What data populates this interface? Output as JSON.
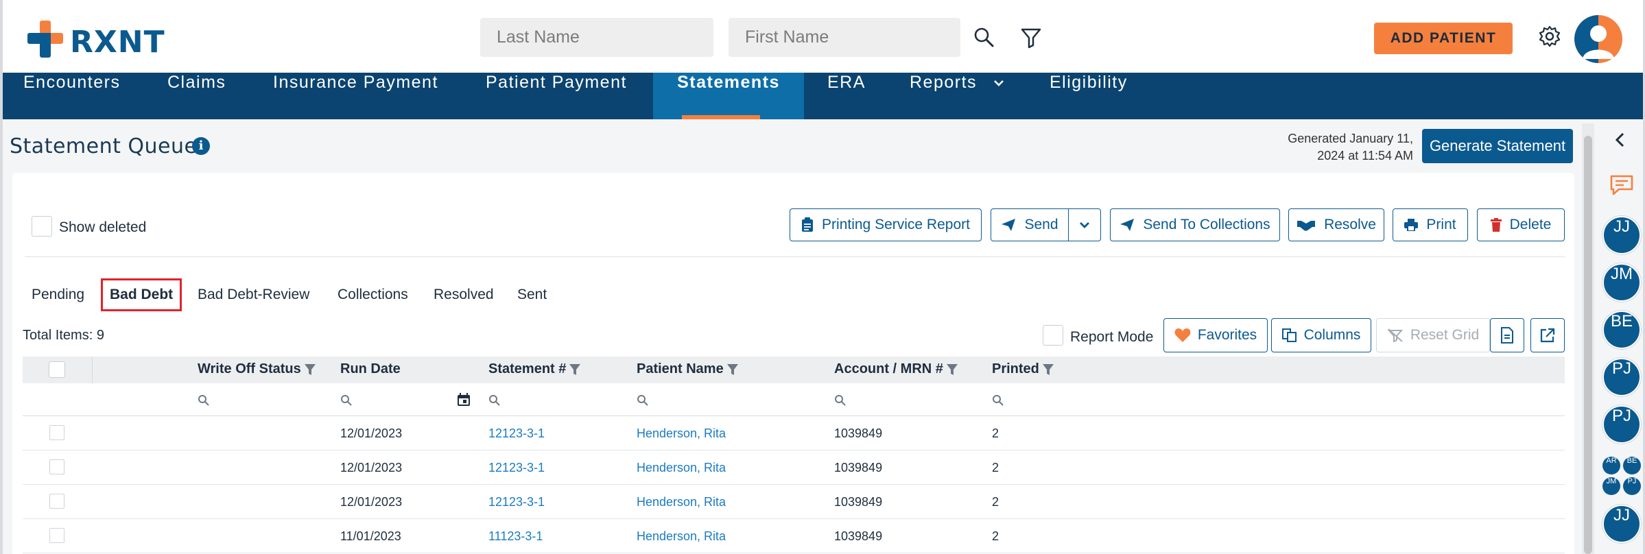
{
  "brand": {
    "name": "RXNT",
    "orange": "#f5803e",
    "navy": "#0b4470",
    "blue": "#0b5a8f"
  },
  "header": {
    "last_name_placeholder": "Last Name",
    "first_name_placeholder": "First Name",
    "search_icon": "search-icon",
    "filter_icon": "filter-icon",
    "add_patient_label": "ADD PATIENT",
    "settings_icon": "gear-icon"
  },
  "nav": {
    "items": [
      {
        "label": "Encounters"
      },
      {
        "label": "Claims"
      },
      {
        "label": "Insurance Payment"
      },
      {
        "label": "Patient Payment"
      },
      {
        "label": "Statements",
        "active": true
      },
      {
        "label": "ERA"
      },
      {
        "label": "Reports"
      },
      {
        "label": "Eligibility"
      }
    ]
  },
  "page": {
    "title": "Statement Queue",
    "generated_line1": "Generated January 11,",
    "generated_line2": "2024 at 11:54 AM",
    "generate_button": "Generate Statement"
  },
  "toolbar": {
    "show_deleted": "Show deleted",
    "printing_service_report": "Printing Service Report",
    "send": "Send",
    "send_to_collections": "Send To Collections",
    "resolve": "Resolve",
    "print": "Print",
    "delete": "Delete"
  },
  "tabs": [
    {
      "label": "Pending"
    },
    {
      "label": "Bad Debt",
      "active": true
    },
    {
      "label": "Bad Debt-Review"
    },
    {
      "label": "Collections"
    },
    {
      "label": "Resolved"
    },
    {
      "label": "Sent"
    }
  ],
  "grid_toolbar": {
    "total_items": "Total Items: 9",
    "report_mode": "Report Mode",
    "favorites": "Favorites",
    "columns": "Columns",
    "reset_grid": "Reset Grid"
  },
  "grid": {
    "columns": [
      "Write Off Status",
      "Run Date",
      "Statement #",
      "Patient Name",
      "Account / MRN #",
      "Printed"
    ],
    "rows": [
      {
        "write_off_status": "",
        "run_date": "12/01/2023",
        "statement": "12123-3-1",
        "patient": "Henderson, Rita",
        "account": "1039849",
        "printed": "2"
      },
      {
        "write_off_status": "",
        "run_date": "12/01/2023",
        "statement": "12123-3-1",
        "patient": "Henderson, Rita",
        "account": "1039849",
        "printed": "2"
      },
      {
        "write_off_status": "",
        "run_date": "12/01/2023",
        "statement": "12123-3-1",
        "patient": "Henderson, Rita",
        "account": "1039849",
        "printed": "2"
      },
      {
        "write_off_status": "",
        "run_date": "11/01/2023",
        "statement": "11123-3-1",
        "patient": "Henderson, Rita",
        "account": "1039849",
        "printed": "2"
      }
    ]
  },
  "rail": {
    "avatars": [
      "JJ",
      "JM",
      "BE",
      "PJ",
      "PJ"
    ],
    "group": [
      "AR",
      "BE",
      "JM",
      "PJ"
    ],
    "last": "JJ"
  }
}
